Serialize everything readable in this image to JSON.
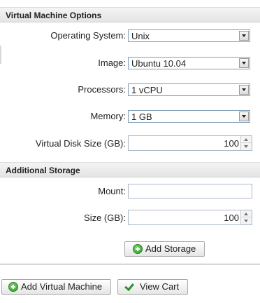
{
  "sections": {
    "vm_options_title": "Virtual Machine Options",
    "additional_storage_title": "Additional Storage"
  },
  "vm": {
    "os_label": "Operating System:",
    "os_value": "Unix",
    "image_label": "Image:",
    "image_value": "Ubuntu 10.04",
    "processors_label": "Processors:",
    "processors_value": "1 vCPU",
    "memory_label": "Memory:",
    "memory_value": "1 GB",
    "disk_label": "Virtual Disk Size (GB):",
    "disk_value": "100"
  },
  "storage": {
    "mount_label": "Mount:",
    "mount_value": "",
    "size_label": "Size (GB):",
    "size_value": "100",
    "add_button": "Add Storage"
  },
  "actions": {
    "add_vm": "Add Virtual Machine",
    "view_cart": "View Cart"
  },
  "icons": {
    "add": "plus-circle-icon",
    "cart": "checkmark-icon"
  },
  "colors": {
    "header_bg": "#e8e8e8",
    "field_border": "#7f9db9",
    "icon_green": "#2e9a2a"
  }
}
